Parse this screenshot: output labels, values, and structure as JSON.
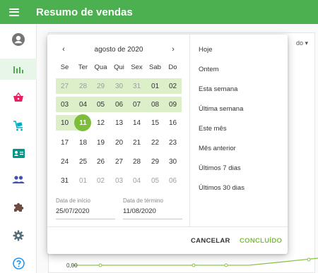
{
  "app": {
    "title": "Resumo de vendas"
  },
  "sidebar": {
    "items": [
      {
        "name": "avatar-icon",
        "color": "#757575"
      },
      {
        "name": "bar-chart-icon",
        "color": "#4caf50"
      },
      {
        "name": "basket-icon",
        "color": "#e91e63"
      },
      {
        "name": "cart-icon",
        "color": "#00acc1"
      },
      {
        "name": "id-card-icon",
        "color": "#009688"
      },
      {
        "name": "people-icon",
        "color": "#3f51b5"
      },
      {
        "name": "puzzle-icon",
        "color": "#6d4c41"
      },
      {
        "name": "gear-icon",
        "color": "#546e7a"
      },
      {
        "name": "help-icon",
        "color": "#2196f3"
      }
    ]
  },
  "background": {
    "select_fragment": "do",
    "axis_tick": "0,00"
  },
  "calendar": {
    "month_label": "agosto de 2020",
    "prev_icon": "‹",
    "next_icon": "›",
    "weekdays": [
      "Se",
      "Ter",
      "Qua",
      "Qui",
      "Sex",
      "Sab",
      "Do"
    ],
    "weeks": [
      [
        "27",
        "28",
        "29",
        "30",
        "31",
        "01",
        "02"
      ],
      [
        "03",
        "04",
        "05",
        "06",
        "07",
        "08",
        "09"
      ],
      [
        "10",
        "11",
        "12",
        "13",
        "14",
        "15",
        "16"
      ],
      [
        "17",
        "18",
        "19",
        "20",
        "21",
        "22",
        "23"
      ],
      [
        "24",
        "25",
        "26",
        "27",
        "28",
        "29",
        "30"
      ],
      [
        "31",
        "01",
        "02",
        "03",
        "04",
        "05",
        "06"
      ]
    ],
    "selected_day": "11",
    "start_label": "Data de início",
    "start_value": "25/07/2020",
    "end_label": "Data de término",
    "end_value": "11/08/2020"
  },
  "presets": [
    "Hoje",
    "Ontem",
    "Esta semana",
    "Última semana",
    "Este mês",
    "Mês anterior",
    "Últimos 7 dias",
    "Últimos 30 dias"
  ],
  "actions": {
    "cancel": "CANCELAR",
    "done": "CONCLUÍDO"
  },
  "colors": {
    "appbar": "#4caf50",
    "range": "#dcefc8",
    "selected": "#7cbd3a"
  }
}
